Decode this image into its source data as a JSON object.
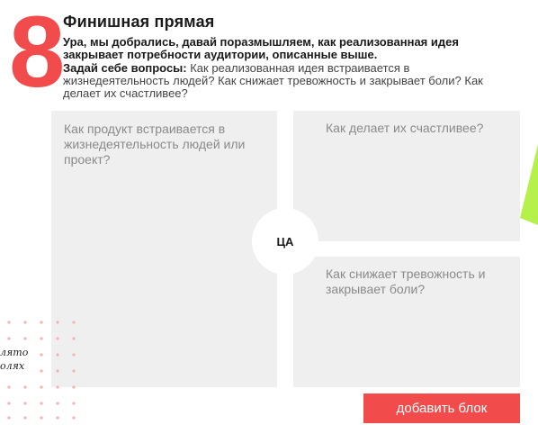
{
  "header": {
    "number": "8",
    "title": "Финишная прямая",
    "intro": "Ура, мы добрались, давай поразмышляем, как реализованная идея закрывает потребности аудитории, описанные выше.",
    "questions_label": "Задай себе вопросы:",
    "questions_text": " Как реализованная идея встраивается в жизнедеятельность людей? Как снижает тревожность и закрывает боли? Как делает их счастливее?"
  },
  "board": {
    "left_panel": "Как продукт встраивается в жизнедеятельность людей или проект?",
    "top_right_panel": "Как делает их счастливее?",
    "bottom_right_panel": "Как снижает тревожность и закрывает боли?",
    "center_label": "ЦА"
  },
  "decor": {
    "handwriting_line1": "лято",
    "handwriting_line2": "олях"
  },
  "actions": {
    "add_block_label": "добавить блок"
  },
  "colors": {
    "accent": "#f24b4b",
    "panel_bg": "#efefef",
    "green_shape": "#b6f04a"
  }
}
